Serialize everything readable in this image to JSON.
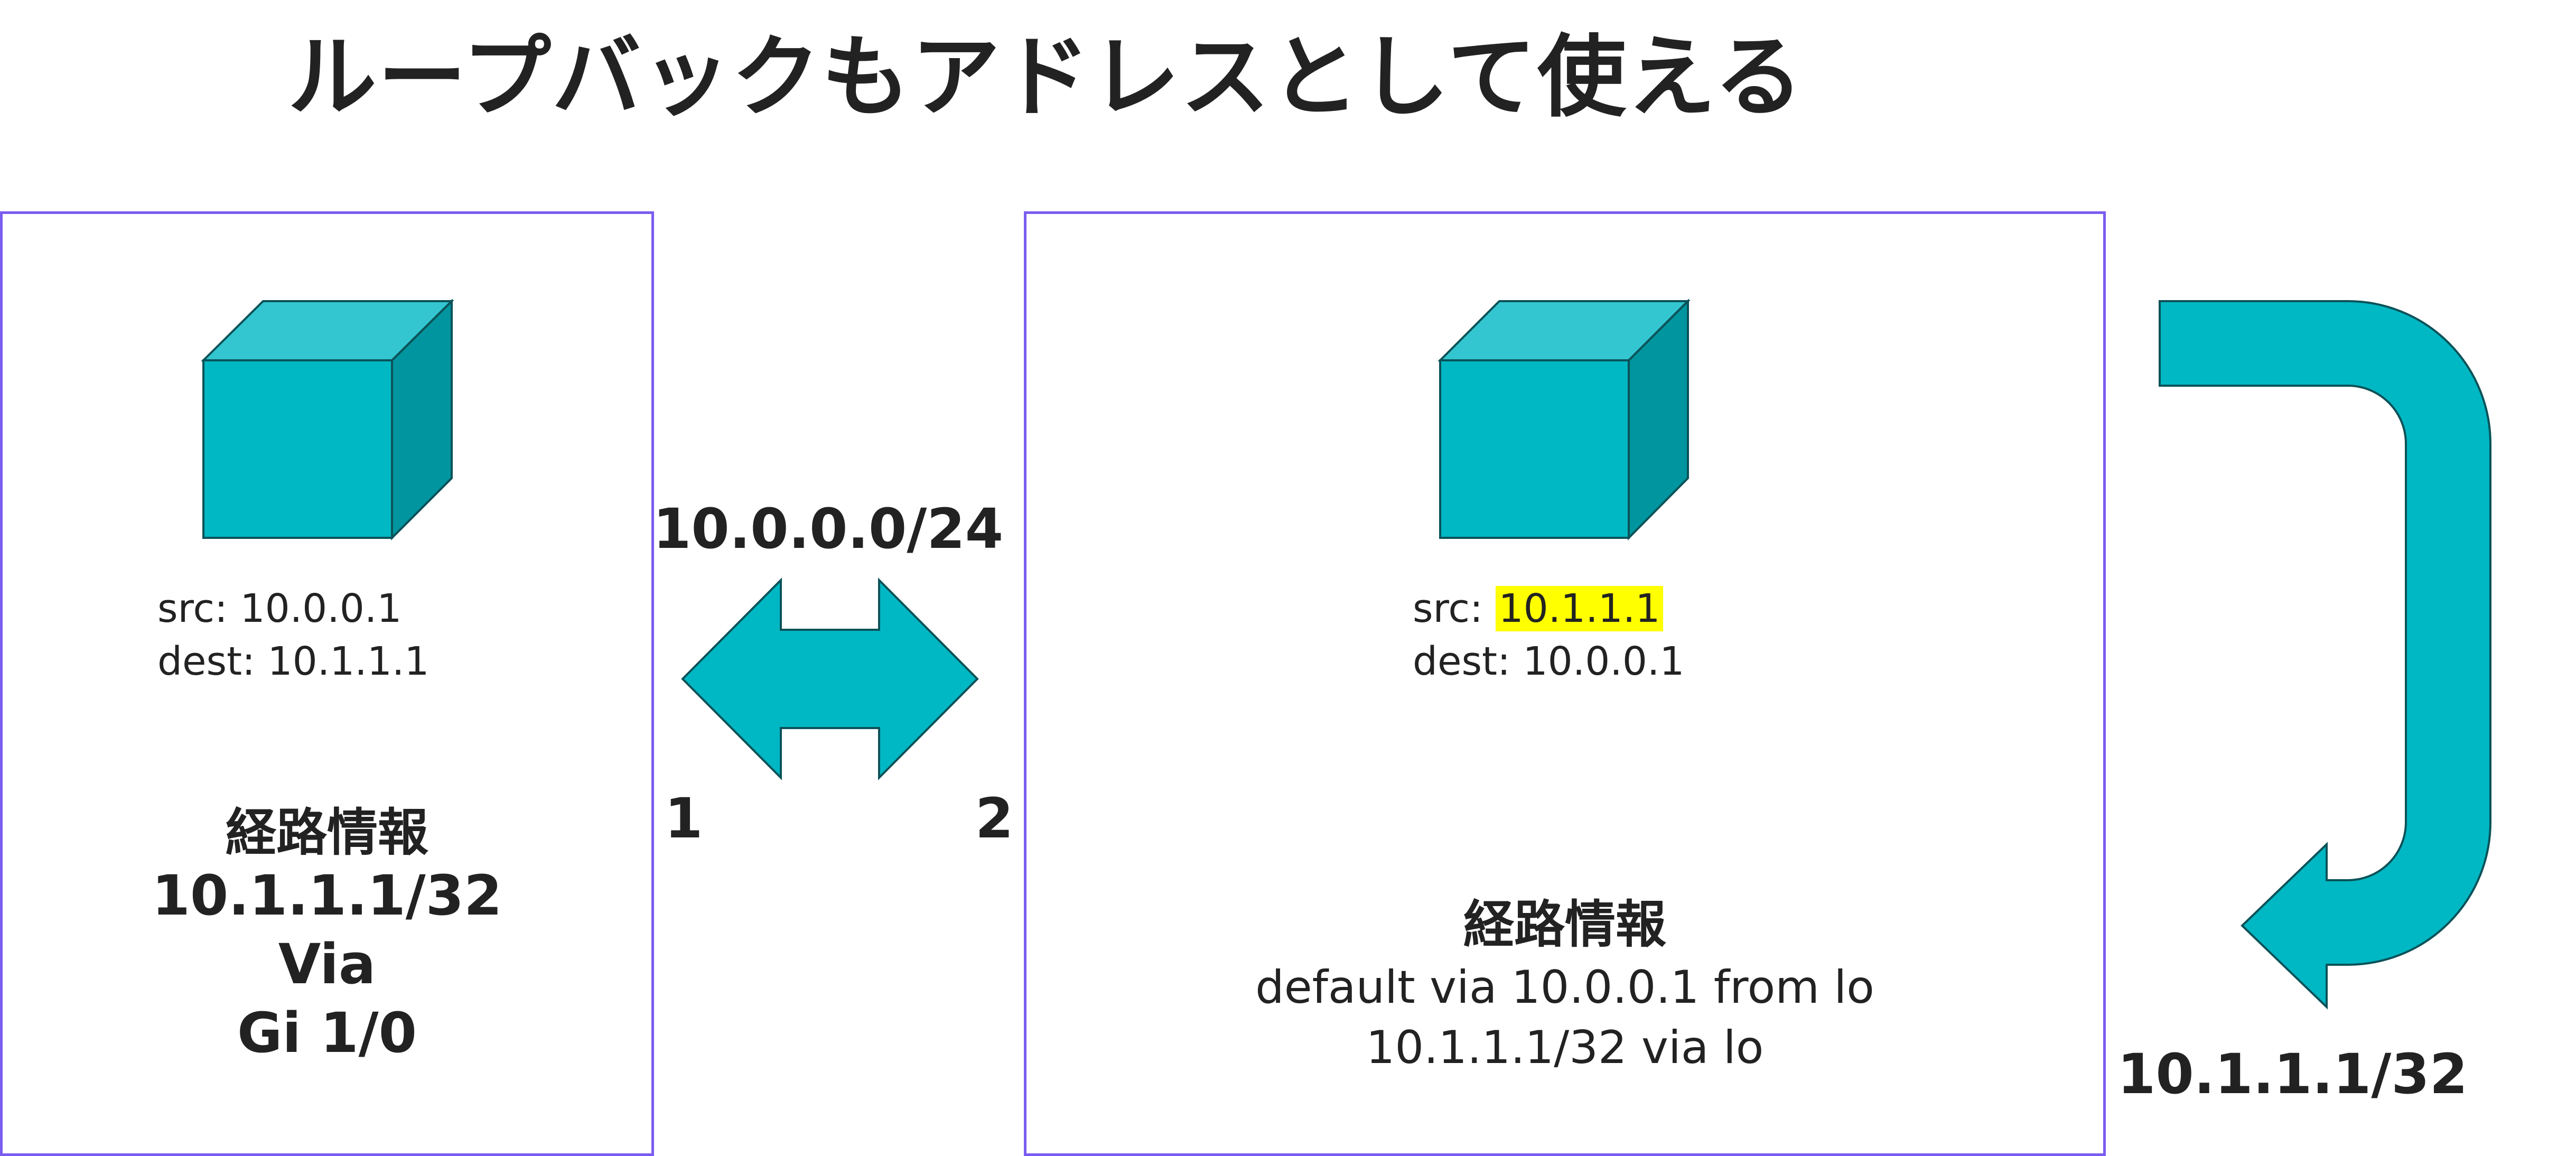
{
  "title": "ループバックもアドレスとして使える",
  "left_host": {
    "src_label": "src:",
    "src_value": "10.0.0.1",
    "dest_label": "dest:",
    "dest_value": "10.1.1.1",
    "routing_heading": "経路情報",
    "routing_lines": [
      "10.1.1.1/32",
      "Via",
      "Gi 1/0"
    ]
  },
  "right_host": {
    "src_label": "src:",
    "src_value": "10.1.1.1",
    "dest_label": "dest:",
    "dest_value": "10.0.0.1",
    "routing_heading": "経路情報",
    "routing_lines": [
      "default via 10.0.0.1 from lo",
      "10.1.1.1/32 via lo"
    ]
  },
  "link": {
    "network": "10.0.0.0/24",
    "port_left": "1",
    "port_right": "2"
  },
  "loopback": {
    "address": "10.1.1.1/32"
  },
  "colors": {
    "panel_border": "#7b5cf0",
    "cube_front": "#00b8c4",
    "cube_top": "#33c6d0",
    "cube_side": "#00959f",
    "arrow_fill": "#00b8c4",
    "highlight": "#ffff00",
    "text": "#222222"
  },
  "icons": {
    "host_icon": "cube-icon",
    "link_arrow": "double-arrow-icon",
    "loopback_arrow": "u-turn-arrow-icon"
  }
}
